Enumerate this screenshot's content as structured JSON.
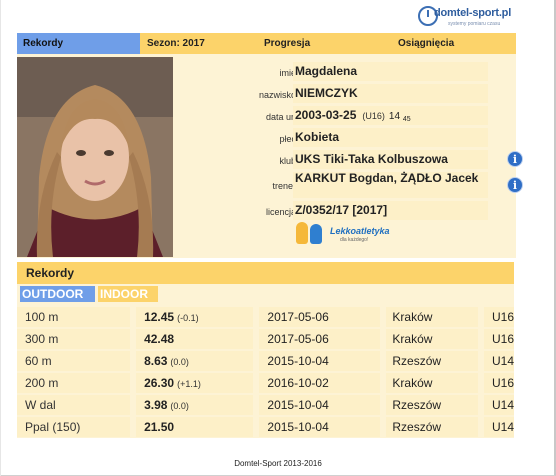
{
  "logo": {
    "brand": "domtel-sport.pl",
    "tagline": "systemy pomiaru czasu",
    "icon": "stopwatch-icon"
  },
  "nav": {
    "tabs": [
      {
        "label": "Rekordy",
        "active": true
      },
      {
        "label": "Sezon: 2017",
        "active": false
      },
      {
        "label": "Progresja",
        "active": false
      },
      {
        "label": "Osiągnięcia",
        "active": false
      }
    ]
  },
  "colors": {
    "accent_yellow": "#fcd36a",
    "accent_blue": "#6f9ee8",
    "panel_bg": "#fdf3d5",
    "info_icon": "#2f6ec6"
  },
  "profile": {
    "fields": [
      {
        "label": "imię",
        "value": "Magdalena"
      },
      {
        "label": "nazwisko",
        "value": "NIEMCZYK"
      },
      {
        "label": "data ur.",
        "value": "2003-03-25",
        "category": "(U16)",
        "age": "14",
        "age_sub": "45"
      },
      {
        "label": "płeć",
        "value": "Kobieta"
      },
      {
        "label": "klub",
        "value": "UKS Tiki-Taka Kolbuszowa",
        "icon": "info-icon"
      },
      {
        "label": "trener",
        "value": "KARKUT Bogdan, ŻĄDŁO Jacek",
        "icon": "info-icon"
      },
      {
        "label": "licencja",
        "value": "Z/0352/17 [2017]"
      }
    ],
    "badge": {
      "title": "Lekkoatletyka",
      "subtitle": "dla każdego!"
    }
  },
  "records": {
    "title": "Rekordy",
    "tabs": [
      {
        "label": "OUTDOOR",
        "active": true
      },
      {
        "label": "INDOOR",
        "active": false
      }
    ],
    "rows": [
      {
        "event": "100 m",
        "result": "12.45",
        "wind": "(-0.1)",
        "date": "2017-05-06",
        "place": "Kraków",
        "category": "U16"
      },
      {
        "event": "300 m",
        "result": "42.48",
        "wind": "",
        "date": "2017-05-06",
        "place": "Kraków",
        "category": "U16"
      },
      {
        "event": "60 m",
        "result": "8.63",
        "wind": "(0.0)",
        "date": "2015-10-04",
        "place": "Rzeszów",
        "category": "U14"
      },
      {
        "event": "200 m",
        "result": "26.30",
        "wind": "(+1.1)",
        "date": "2016-10-02",
        "place": "Kraków",
        "category": "U16"
      },
      {
        "event": "W dal",
        "result": "3.98",
        "wind": "(0.0)",
        "date": "2015-10-04",
        "place": "Rzeszów",
        "category": "U14"
      },
      {
        "event": "Ppal (150)",
        "result": "21.50",
        "wind": "",
        "date": "2015-10-04",
        "place": "Rzeszów",
        "category": "U14"
      }
    ]
  },
  "footer": {
    "text": "Domtel-Sport 2013-2016"
  }
}
